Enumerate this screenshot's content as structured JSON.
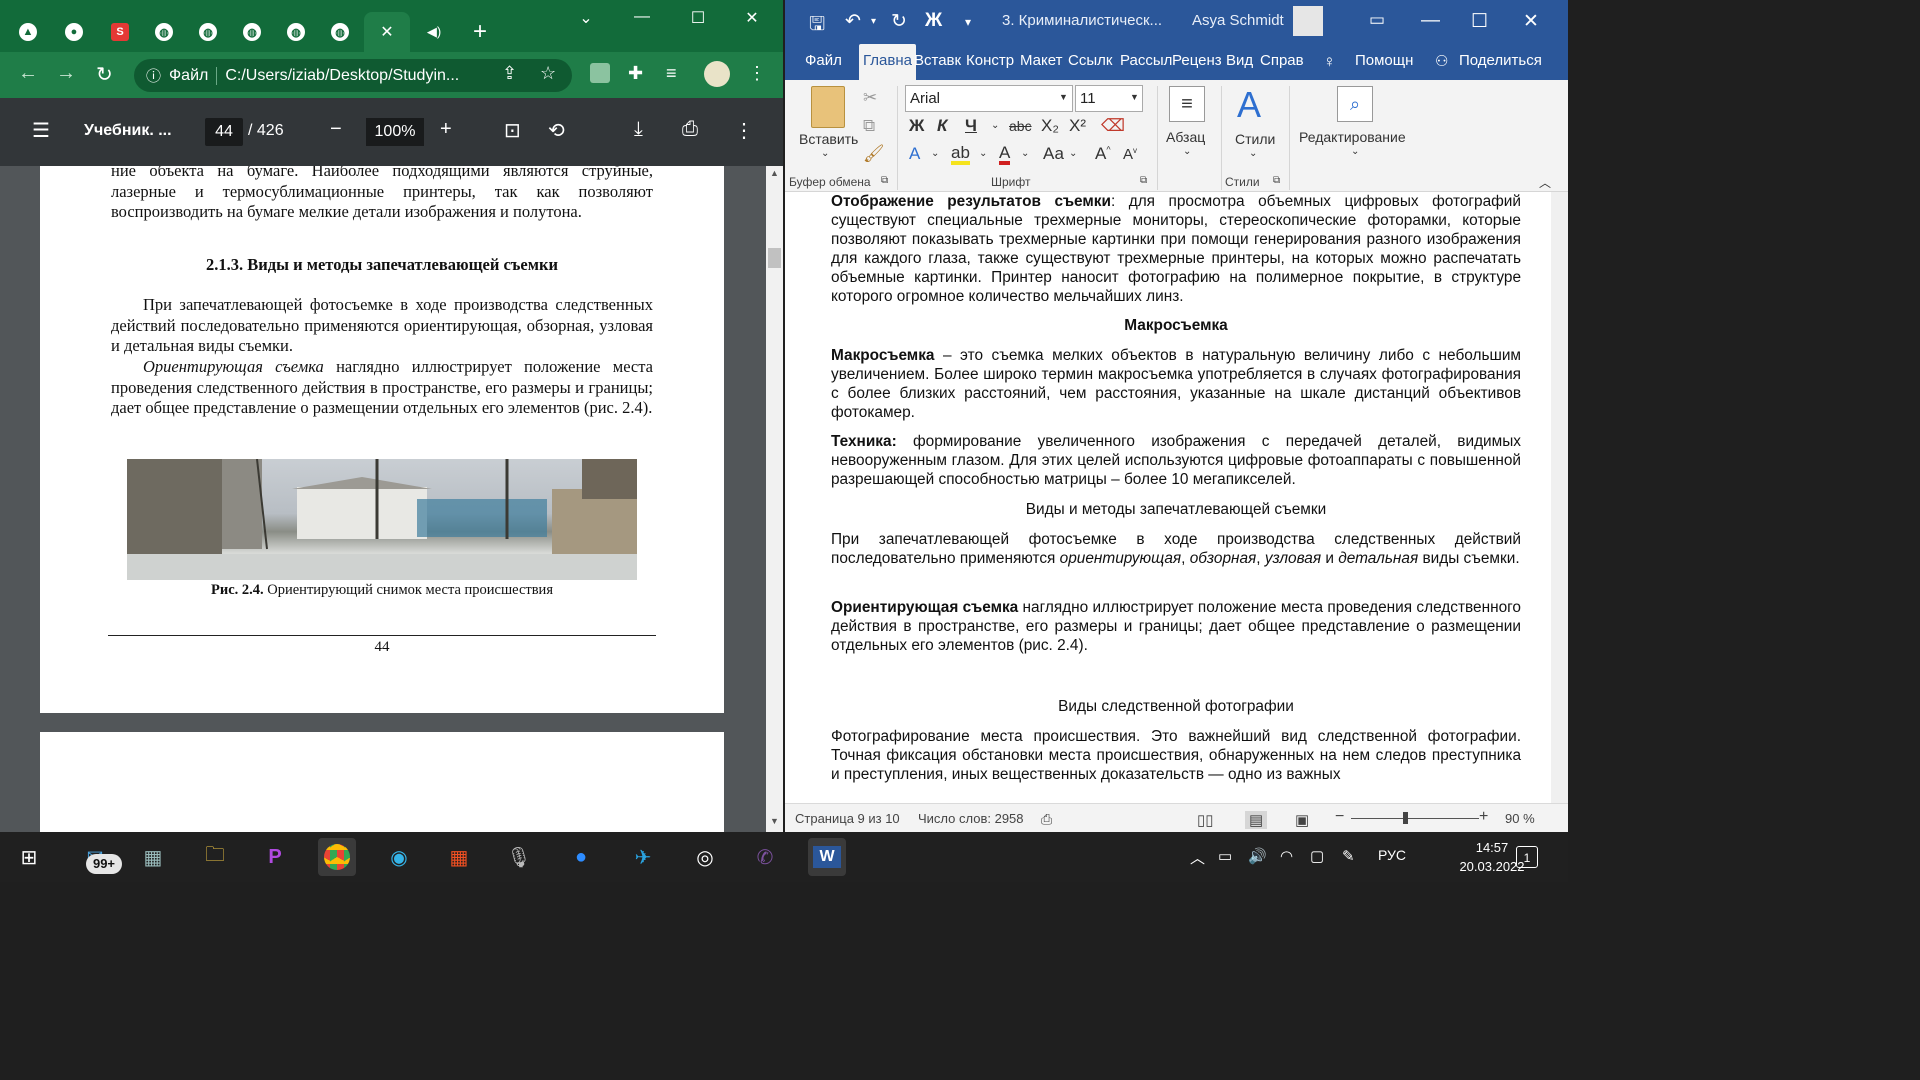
{
  "chrome": {
    "tabs_icons": [
      "flag-icon",
      "avatar-icon",
      "s-icon",
      "globe-icon",
      "globe-icon",
      "globe-icon",
      "globe-icon",
      "active-tab",
      "audio-icon"
    ],
    "new_tab": "+",
    "address_label": "Файл",
    "address_url": "C:/Users/iziab/Desktop/Studyin...",
    "pdf": {
      "title": "Учебник. ...",
      "page_current": "44",
      "page_total": "/ 426",
      "zoom": "100%",
      "paragraphs": {
        "p0": "ние объекта на бумаге. Наиболее подходящими являются струйные, лазерные и термосублимационные принтеры, так как позволяют воспроизводить на бумаге мелкие детали изображения и полутона.",
        "h1": "2.1.3. Виды и методы запечатлевающей съемки",
        "p1": "При запечатлевающей фотосъемке в ходе производства следственных действий последовательно применяются ориентирующая, обзорная, узловая и детальная виды съемки.",
        "p2_em": "Ориентирующая съемка",
        "p2": " наглядно иллюстрирует положение места проведения следственного действия в пространстве, его размеры и границы; дает общее представление о размещении отдельных его элементов (рис. 2.4).",
        "caption_bold": "Рис. 2.4.",
        "caption": " Ориентирующий снимок места происшествия",
        "page_number": "44"
      }
    }
  },
  "word": {
    "title": "3. Криминалистическ...",
    "user": "Asya Schmidt",
    "tabs": [
      "Файл",
      "Главна",
      "Вставк",
      "Констр",
      "Макет",
      "Ссылк",
      "Рассыл",
      "Реценз",
      "Вид",
      "Справ",
      "Помощн",
      "Поделиться"
    ],
    "ribbon": {
      "paste": "Вставить",
      "clipboard": "Буфер обмена",
      "font_name": "Arial",
      "font_size": "11",
      "font_group": "Шрифт",
      "paragraph": "Абзац",
      "styles": "Стили",
      "styles_group": "Стили",
      "editing": "Редактирование"
    },
    "doc": {
      "p1_bold": "Отображение результатов съемки",
      "p1": ": для просмотра объемных цифровых фотографий существуют специальные трехмерные мониторы, стереоскопические фоторамки, которые позволяют показывать трехмерные картинки при помощи генерирования разного изображения для каждого глаза, также существуют трехмерные принтеры, на которых можно распечатать объемные картинки. Принтер наносит фотографию на полимерное покрытие, в структуре которого огромное количество мельчайших линз.",
      "h_macro": "Макросъемка",
      "p2_bold": "Макросъемка",
      "p2": " – это съемка мелких объектов в натуральную величину либо с небольшим увеличением. Более широко термин макросъемка употребляется в случаях фотографирования с более близких расстояний, чем расстояния, указанные на шкале дистанций объективов фотокамер.",
      "p3_bold": "Техника:",
      "p3": " формирование увеличенного изображения с передачей деталей, видимых невооруженным глазом. Для этих целей используются цифровые фотоаппараты с повышенной разрешающей способностью матрицы – более 10 мегапикселей.",
      "h_methods": "Виды и методы запечатлевающей съемки",
      "p4a": "При запечатлевающей фотосъемке в ходе производства следственных действий последовательно применяются ",
      "p4i1": "ориентирующая",
      "p4c1": ", ",
      "p4i2": "обзорная",
      "p4c2": ", ",
      "p4i3": "узловая",
      "p4c3": " и ",
      "p4i4": "детальная",
      "p4b": " виды съемки.",
      "p5_bold": "Ориентирующая съемка",
      "p5": " наглядно иллюстрирует положение места проведения следственного действия в пространстве, его размеры и границы; дает общее представление о размещении отдельных его элементов (рис. 2.4).",
      "h_types": "Виды следственной фотографии",
      "p6": "Фотографирование места происшествия. Это важнейший вид следственной фотографии. Точная фиксация обстановки места происшествия, обнаруженных на нем следов преступника и преступления, иных вещественных доказательств — одно из важных"
    },
    "status": {
      "page": "Страница 9 из 10",
      "words": "Число слов: 2958",
      "zoom": "90 %",
      "zoom_fraction": 0.42
    }
  },
  "taskbar": {
    "mail_badge": "99+",
    "lang": "РУС",
    "time": "14:57",
    "date": "20.03.2022",
    "notifications": "1"
  }
}
